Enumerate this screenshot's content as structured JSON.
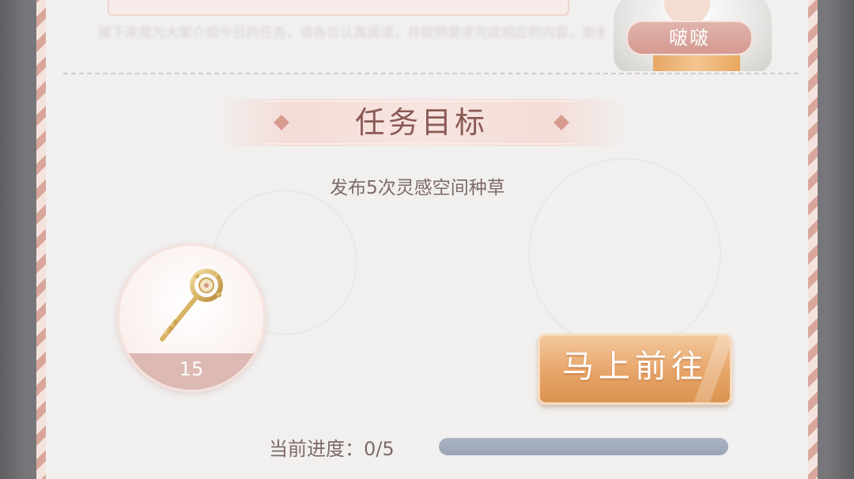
{
  "dialog": {
    "speaker_name": "啵啵",
    "blurred_text": "接下来我为大家介绍今日的任务，请各位认真阅读，并按照要求完成相应的内容，谢谢大家的配合"
  },
  "section": {
    "title": "任务目标"
  },
  "task": {
    "description": "发布5次灵感空间种草"
  },
  "reward": {
    "icon": "golden-key-icon",
    "count": "15"
  },
  "actions": {
    "go_label": "马上前往"
  },
  "progress": {
    "label": "当前进度：0/5",
    "current": 0,
    "total": 5
  },
  "colors": {
    "accent": "#e7a569",
    "title": "#8a5a54",
    "border": "#d9a69b"
  }
}
